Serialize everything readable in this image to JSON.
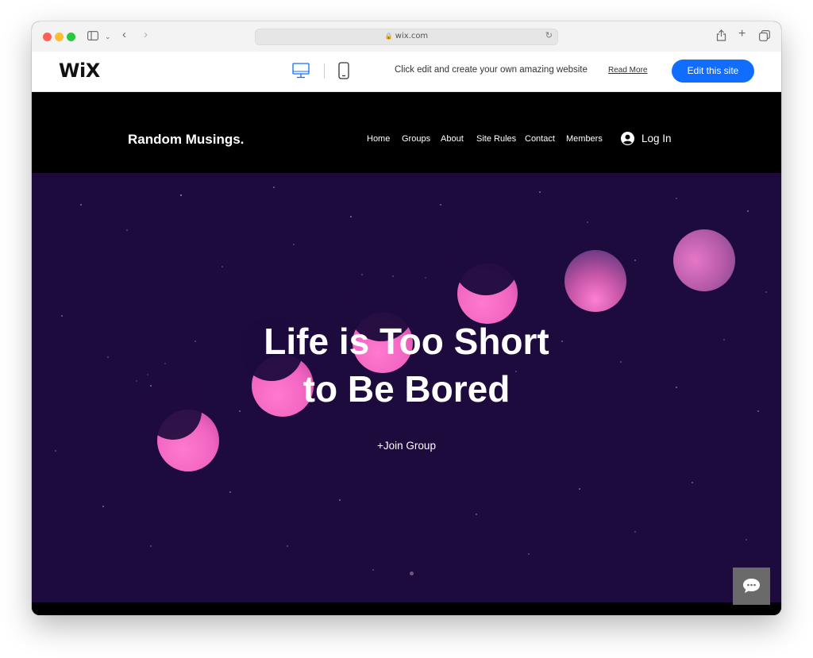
{
  "browser": {
    "url": "wix.com"
  },
  "wix_bar": {
    "logo": "WiX",
    "promo_text": "Click edit and create your own amazing website",
    "read_more": "Read More",
    "edit_button": "Edit this site"
  },
  "site": {
    "title": "Random Musings.",
    "nav": [
      "Home",
      "Groups",
      "About",
      "Site Rules",
      "Contact",
      "Members"
    ],
    "login": "Log In"
  },
  "hero": {
    "headline_line1": "Life is Too Short",
    "headline_line2": "to Be Bored",
    "join_button": "+Join Group"
  },
  "colors": {
    "hero_background": "#1e0b3d",
    "moon_pink": "#ff6fc8",
    "wix_blue": "#116dff"
  },
  "icons": {
    "sidebar": "sidebar-icon",
    "back": "back-chevron-icon",
    "forward": "forward-chevron-icon",
    "lock": "lock-icon",
    "reload": "reload-icon",
    "share": "share-icon",
    "new_tab": "plus-icon",
    "tabs": "tabs-overview-icon",
    "desktop": "desktop-icon",
    "mobile": "mobile-icon",
    "user": "user-icon",
    "chat": "chat-icon"
  }
}
